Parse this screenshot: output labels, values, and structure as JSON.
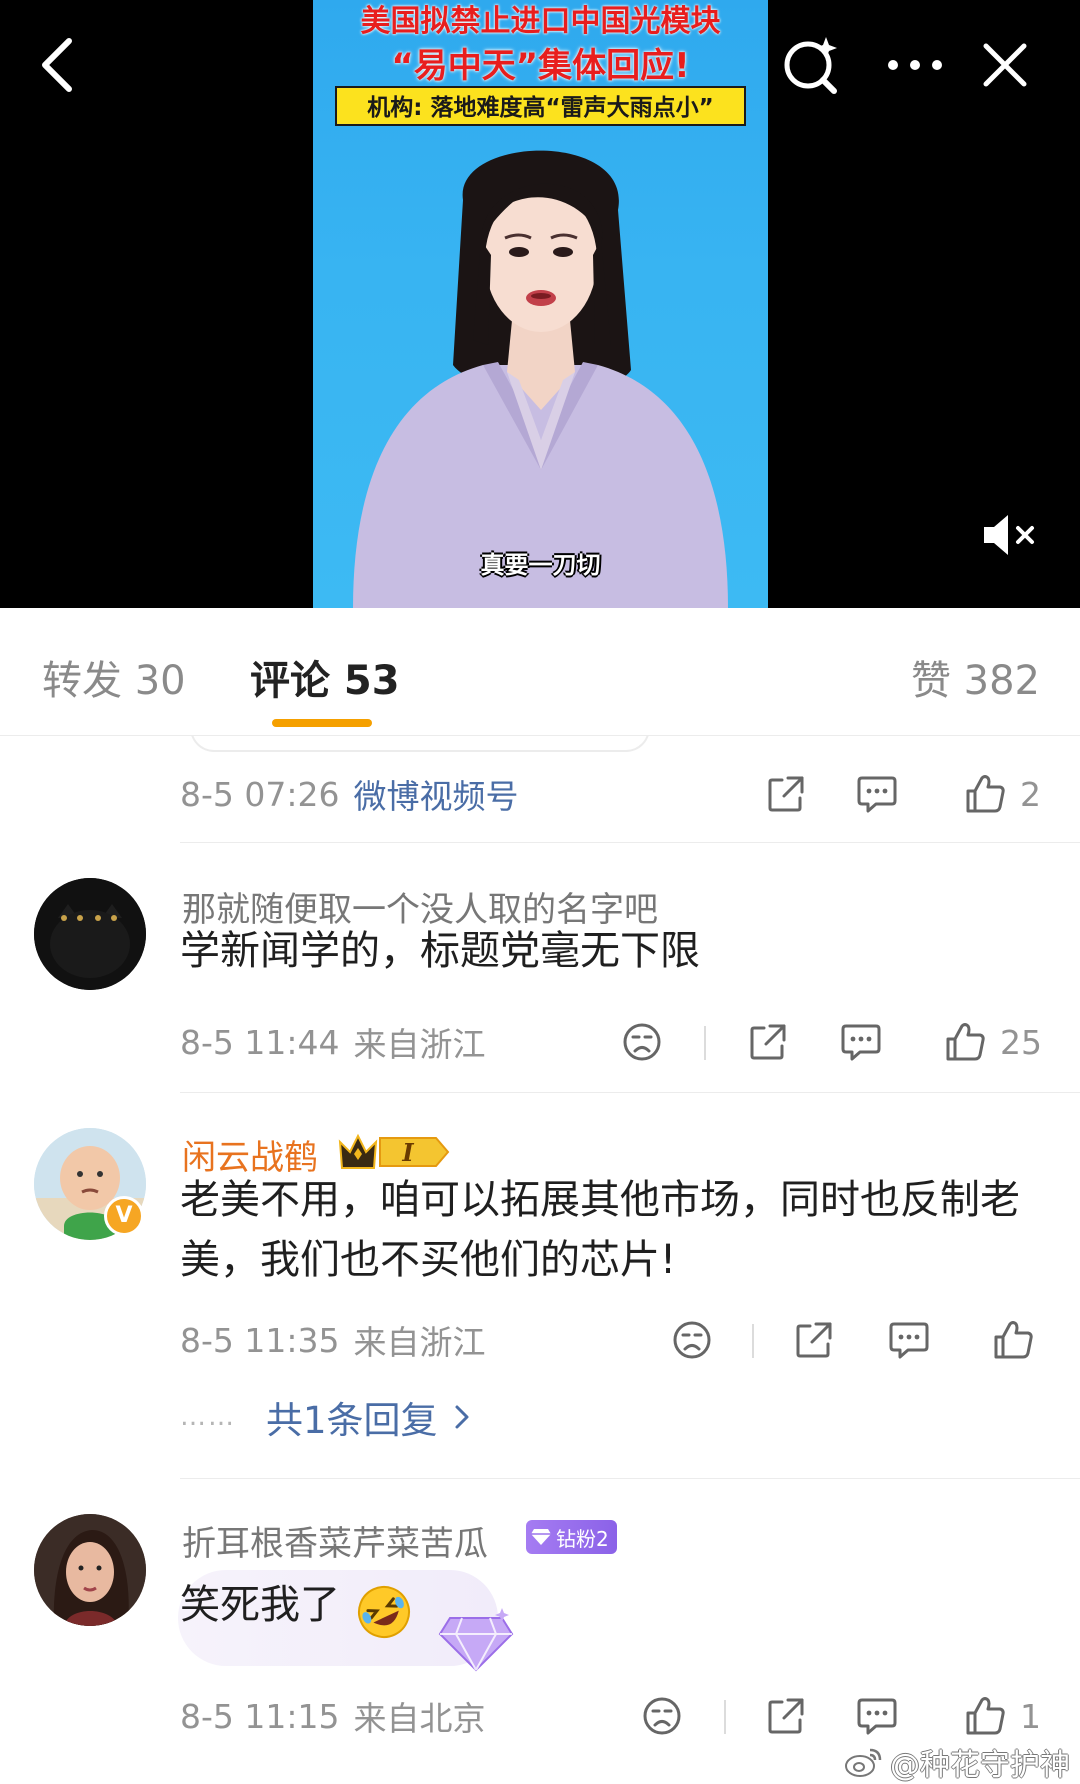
{
  "video": {
    "headline_line1": "美国拟禁止进口中国光模块",
    "headline_line2": "“易中天”集体回应!",
    "headline_line3": "机构: 落地难度高“雷声大雨点小”",
    "subtitle": "真要一刀切"
  },
  "icons": {
    "back": "chevron-left-icon",
    "search": "search-sparkle-icon",
    "more": "more-dots-icon",
    "close": "close-icon",
    "mute": "speaker-muted-icon",
    "share": "share-icon",
    "comment": "comment-icon",
    "like": "thumbs-up-icon",
    "dislike": "sad-face-icon"
  },
  "tabs": {
    "repost": "转发 30",
    "comments": "评论 53",
    "likes": "赞 382"
  },
  "original_post_meta": {
    "time": "8-5 07:26",
    "source": "微博视频号",
    "like_count": "2"
  },
  "comments": [
    {
      "username": "那就随便取一个没人取的名字吧",
      "text": "学新闻学的，标题党毫无下限",
      "time": "8-5 11:44",
      "location": "来自浙江",
      "like_count": "25"
    },
    {
      "username": "闲云战鹤",
      "vip_level": "I",
      "verified_mark": "V",
      "text": "老美不用，咱可以拓展其他市场，同时也反制老美，我们也不买他们的芯片!",
      "time": "8-5 11:35",
      "location": "来自浙江",
      "like_count": "",
      "replies_label": "共1条回复",
      "replies_dots": "……"
    },
    {
      "username": "折耳根香菜芹菜苦瓜",
      "fan_badge": "钻粉2",
      "text": "笑死我了",
      "time": "8-5 11:15",
      "location": "来自北京",
      "like_count": "1"
    }
  ],
  "watermark": "@种花守护神",
  "colors": {
    "accent_tab_underline": "#f5a000",
    "link_blue": "#4a6da6",
    "vip_name_orange": "#e8731f",
    "fan_badge_purple": "#8b62e8",
    "video_bg_blue": "#38b4f2",
    "headline_red": "#e81e1e",
    "headline_yellow": "#fce21e"
  }
}
